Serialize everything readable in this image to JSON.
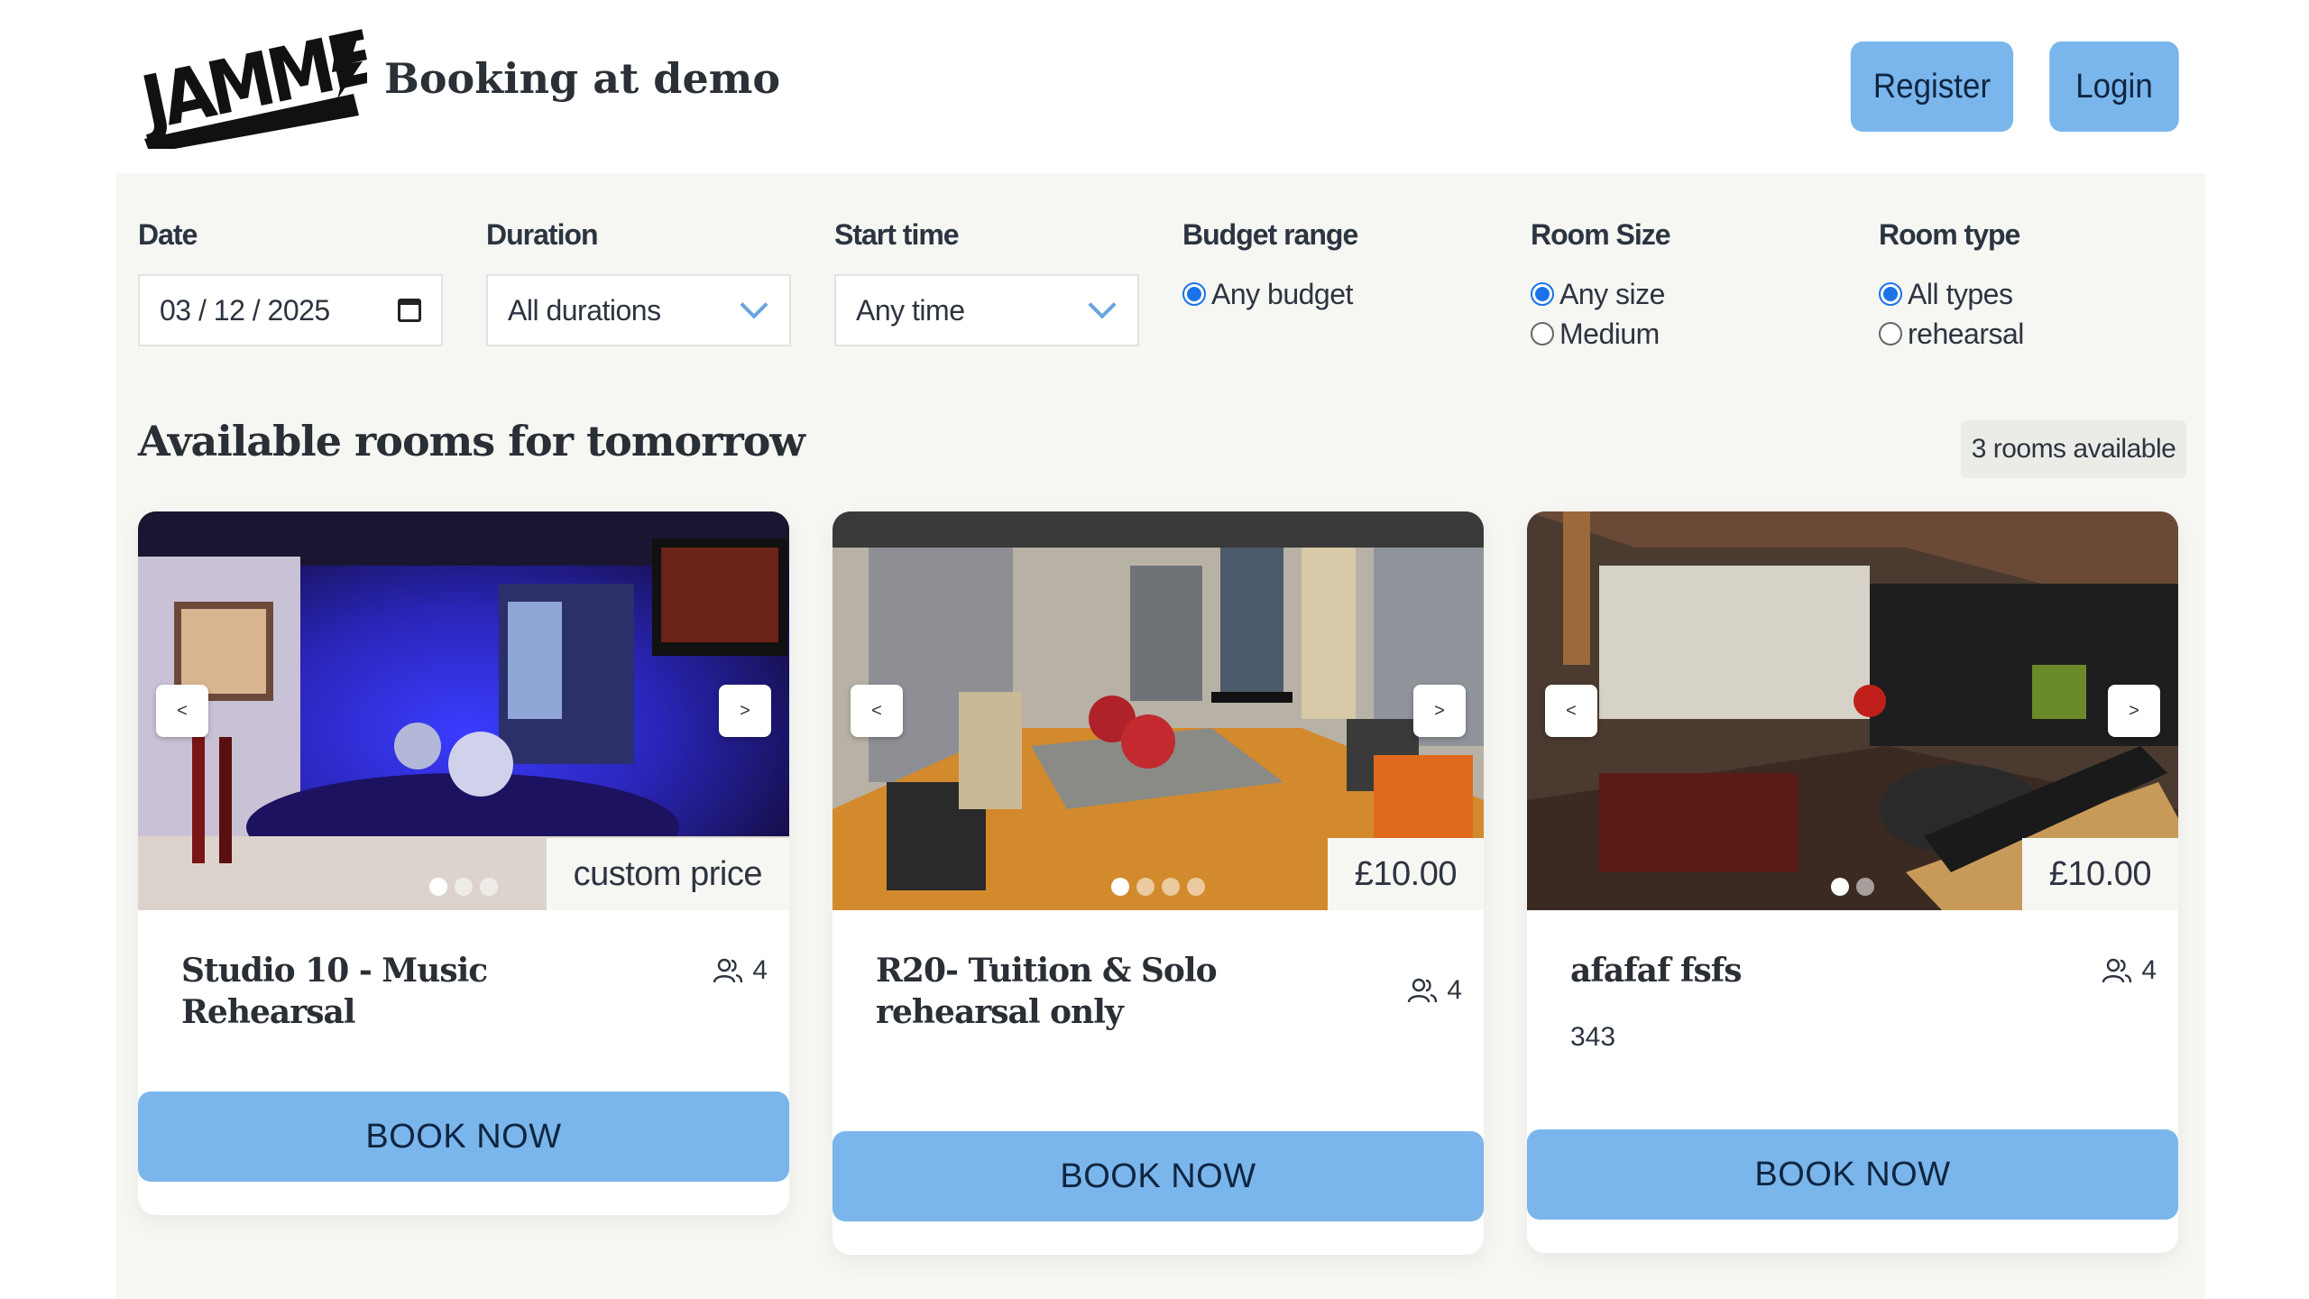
{
  "header": {
    "logo_text": "JAMMED",
    "site_title": "Booking at demo",
    "register_label": "Register",
    "login_label": "Login"
  },
  "filters": {
    "date": {
      "label": "Date",
      "value": "03 / 12 / 2025"
    },
    "duration": {
      "label": "Duration",
      "value": "All durations"
    },
    "start_time": {
      "label": "Start time",
      "value": "Any time"
    },
    "budget": {
      "label": "Budget range",
      "options": [
        "Any budget"
      ],
      "selected": "Any budget"
    },
    "room_size": {
      "label": "Room Size",
      "options": [
        "Any size",
        "Medium"
      ],
      "selected": "Any size"
    },
    "room_type": {
      "label": "Room type",
      "options": [
        "All types",
        "rehearsal"
      ],
      "selected": "All types"
    }
  },
  "listing": {
    "title": "Available rooms for tomorrow",
    "count_text": "3 rooms available"
  },
  "rooms": [
    {
      "name": "Studio 10 - Music Rehearsal",
      "capacity": "4",
      "price": "custom price",
      "description": "",
      "photos": 3,
      "active_photo": 1,
      "book_label": "BOOK NOW",
      "prev": "<",
      "next": ">"
    },
    {
      "name": "R20- Tuition & Solo rehearsal only",
      "capacity": "4",
      "price": "£10.00",
      "description": "",
      "photos": 4,
      "active_photo": 1,
      "book_label": "BOOK NOW",
      "prev": "<",
      "next": ">"
    },
    {
      "name": "afafaf fsfs",
      "capacity": "4",
      "price": "£10.00",
      "description": "343",
      "photos": 2,
      "active_photo": 1,
      "book_label": "BOOK NOW",
      "prev": "<",
      "next": ">"
    }
  ],
  "colors": {
    "accent": "#7ab6ec",
    "panel": "#f6f6f3",
    "radio": "#1a73e8"
  }
}
